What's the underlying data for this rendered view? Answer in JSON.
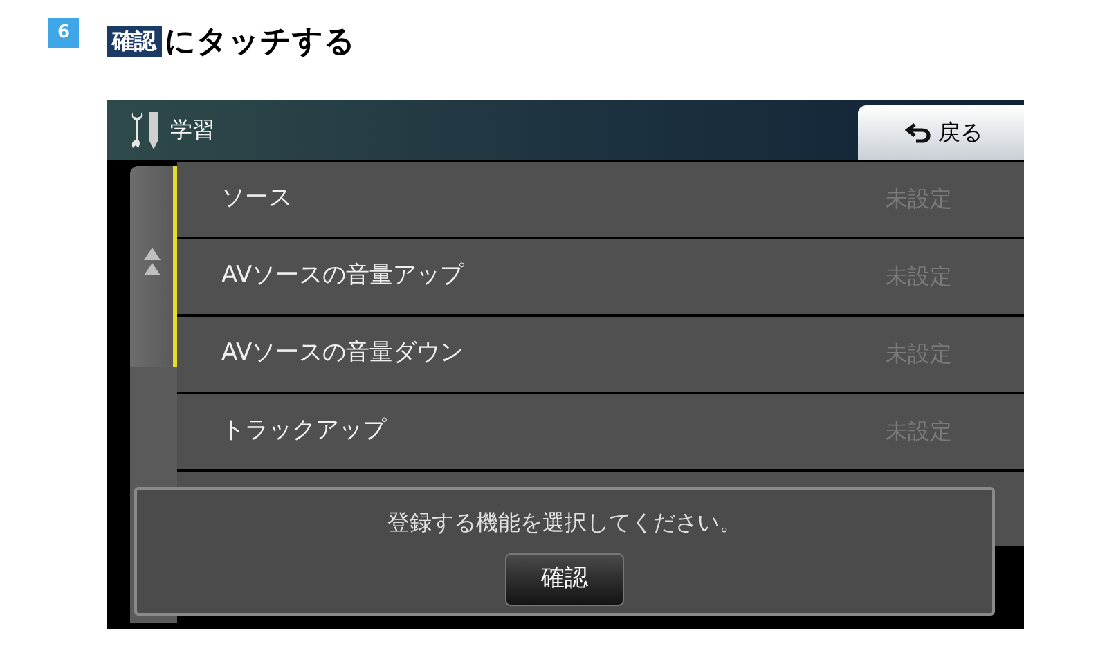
{
  "step": {
    "number": "6",
    "button_label": "確認",
    "instruction": "にタッチする"
  },
  "screen": {
    "title": "学習",
    "back_button": "戻る",
    "rows": [
      {
        "label": "ソース",
        "value": "未設定"
      },
      {
        "label": "AVソースの音量アップ",
        "value": "未設定"
      },
      {
        "label": "AVソースの音量ダウン",
        "value": "未設定"
      },
      {
        "label": "トラックアップ",
        "value": "未設定"
      }
    ],
    "dialog": {
      "message": "登録する機能を選択してください。",
      "button": "確認"
    }
  }
}
